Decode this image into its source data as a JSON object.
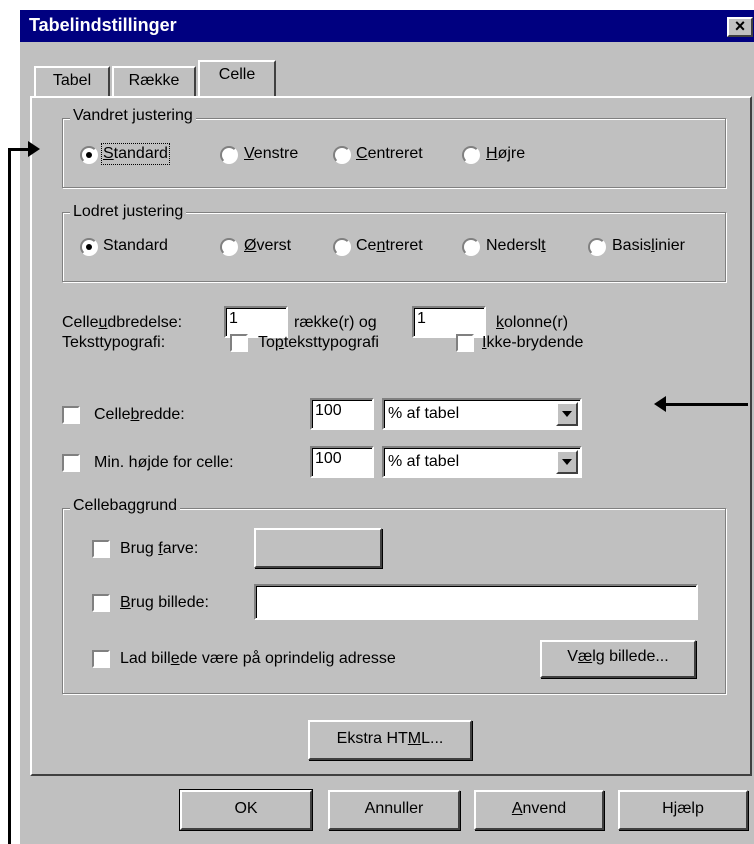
{
  "window": {
    "title": "Tabelindstillinger",
    "close_glyph": "×"
  },
  "tabs": [
    {
      "label": "Tabel"
    },
    {
      "label": "Række"
    },
    {
      "label": "Celle",
      "active": true
    }
  ],
  "horizontal_alignment": {
    "legend": "Vandret justering",
    "options": [
      "Standard",
      "Venstre",
      "Centreret",
      "Højre"
    ],
    "selected": "Standard"
  },
  "vertical_alignment": {
    "legend": "Lodret justering",
    "options": [
      "Standard",
      "Øverst",
      "Centreret",
      "Nederst",
      "Basislinier"
    ],
    "selected": "Standard"
  },
  "cell_span": {
    "label": "Celleudbredelse:",
    "rows_value": "1",
    "rows_label": "række(r) og",
    "cols_value": "1",
    "cols_label": "kolonne(r)"
  },
  "text_style": {
    "label": "Teksttypografi:",
    "header_label": "Topteksttypografi",
    "nowrap_label": "Ikke-brydende"
  },
  "cell_width": {
    "label": "Cellebredde:",
    "value": "100",
    "unit": "% af tabel"
  },
  "min_height": {
    "label": "Min. højde for celle:",
    "value": "100",
    "unit": "% af tabel"
  },
  "background": {
    "legend": "Cellebaggrund",
    "use_color_label": "Brug farve:",
    "use_image_label": "Brug billede:",
    "image_value": "",
    "keep_original_label": "Lad billede være på oprindelig adresse",
    "choose_image_label": "Vælg billede..."
  },
  "extra_html_label": "Ekstra HTML...",
  "buttons": {
    "ok": "OK",
    "cancel": "Annuller",
    "apply": "Anvend",
    "help": "Hjælp"
  },
  "colors": {
    "titlebar": "#000080",
    "face": "#c0c0c0"
  }
}
